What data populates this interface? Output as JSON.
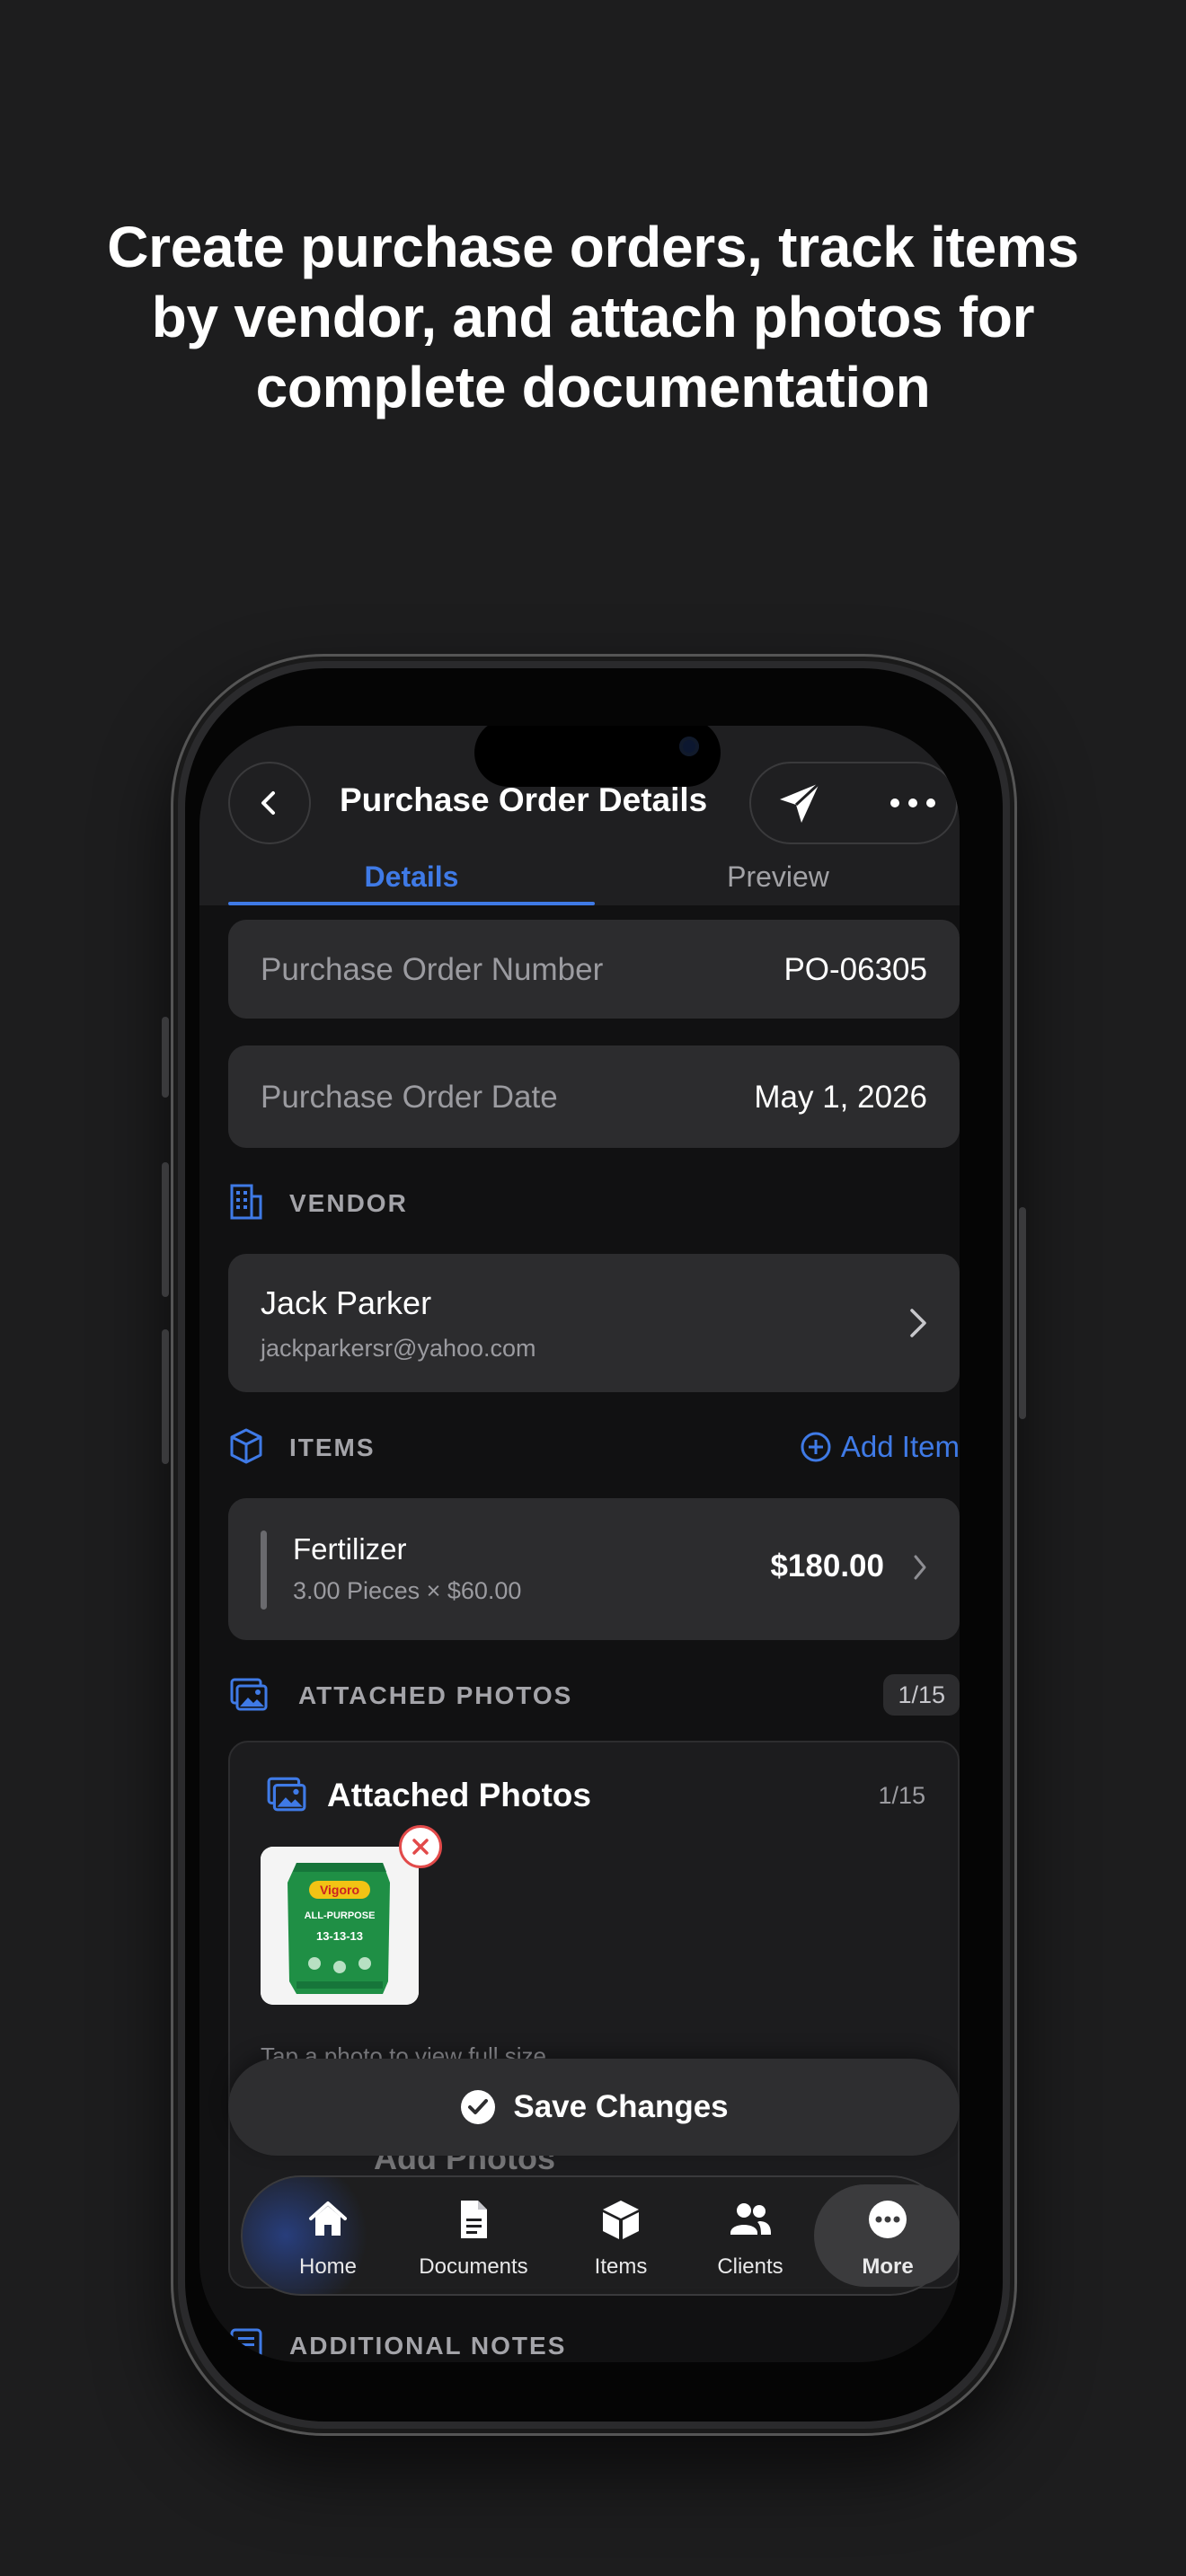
{
  "headline": {
    "line1": "Create purchase orders, track items",
    "line2": "by vendor, and attach photos for",
    "line3": "complete documentation"
  },
  "header": {
    "title": "Purchase Order Details",
    "back_icon": "chevron-left-icon",
    "send_icon": "paper-plane-icon",
    "more_icon": "ellipsis-icon"
  },
  "tabs": [
    {
      "label": "Details",
      "active": true
    },
    {
      "label": "Preview",
      "active": false
    }
  ],
  "po_number": {
    "label": "Purchase Order Number",
    "value": "PO-06305"
  },
  "po_date": {
    "label": "Purchase Order Date",
    "value": "May 1, 2026"
  },
  "vendor_section": {
    "label": "VENDOR",
    "icon": "building-icon"
  },
  "vendor": {
    "name": "Jack Parker",
    "email": "jackparkersr@yahoo.com"
  },
  "items_section": {
    "label": "ITEMS",
    "icon": "box-icon",
    "add_label": "Add Item"
  },
  "items": [
    {
      "name": "Fertilizer",
      "detail": "3.00 Pieces × $60.00",
      "total": "$180.00"
    }
  ],
  "photos_section": {
    "label": "ATTACHED PHOTOS",
    "icon": "photos-icon",
    "count": "1/15"
  },
  "photos_box": {
    "title": "Attached Photos",
    "count": "1/15",
    "hint": "Tap a photo to view full size",
    "add_label": "Add Photos",
    "thumb_text": {
      "brand": "Vigoro",
      "line1": "ALL-PURPOSE",
      "line2": "13-13-13"
    }
  },
  "save_button": {
    "label": "Save Changes"
  },
  "notes_section": {
    "label": "ADDITIONAL NOTES",
    "icon": "notes-icon"
  },
  "tabbar": [
    {
      "label": "Home",
      "icon": "house-icon"
    },
    {
      "label": "Documents",
      "icon": "document-icon"
    },
    {
      "label": "Items",
      "icon": "box-icon"
    },
    {
      "label": "Clients",
      "icon": "people-icon"
    },
    {
      "label": "More",
      "icon": "ellipsis-circle-icon",
      "active": true
    }
  ],
  "colors": {
    "accent": "#3f7ae6",
    "background": "#1d1d1e",
    "card": "#2c2c2e",
    "danger": "#e24a4a"
  }
}
